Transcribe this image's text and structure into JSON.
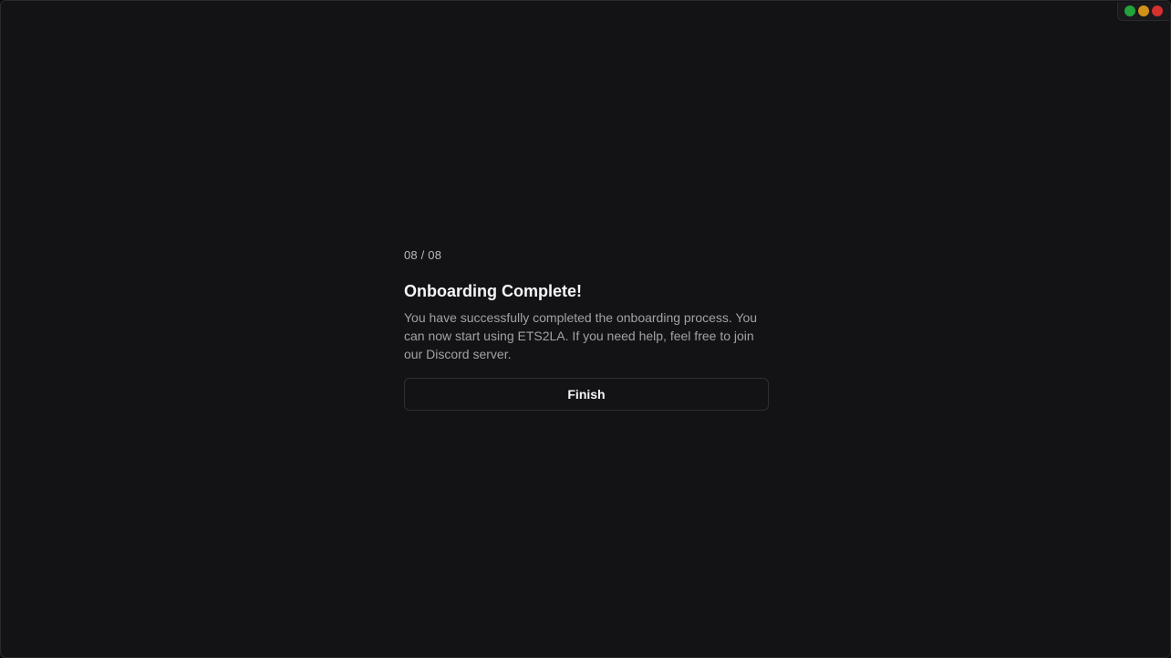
{
  "window_controls": {
    "colors": {
      "minimize": "#22a33b",
      "maximize": "#d1921a",
      "close": "#d63031"
    },
    "icons": [
      "green-dot-icon",
      "yellow-dot-icon",
      "red-dot-icon"
    ]
  },
  "onboarding": {
    "step_indicator": "08 / 08",
    "title": "Onboarding Complete!",
    "description": "You have successfully completed the onboarding process. You can now start using ETS2LA. If you need help, feel free to join our Discord server.",
    "finish_label": "Finish"
  },
  "theme": {
    "background": "#131315",
    "text_primary": "#f5f5f7",
    "text_secondary": "#a1a1a8",
    "border": "#2e2e33"
  }
}
